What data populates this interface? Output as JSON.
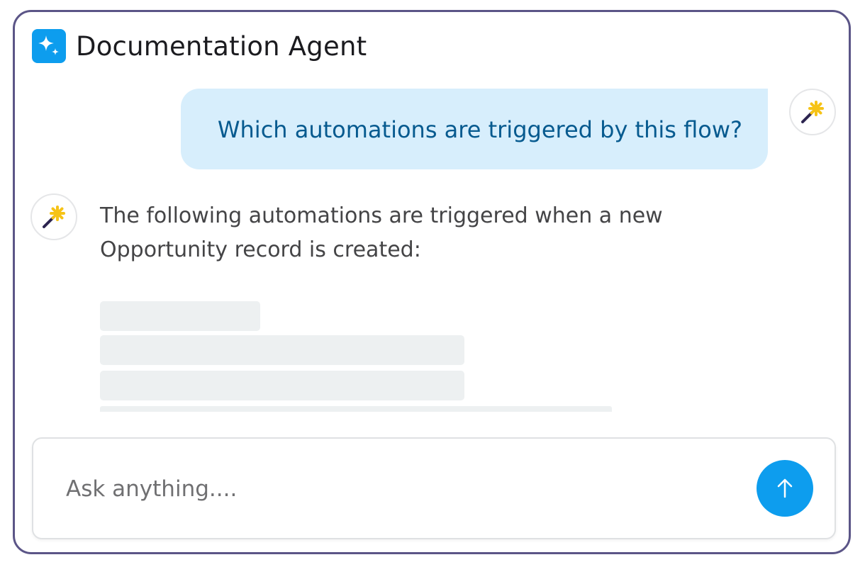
{
  "header": {
    "title": "Documentation Agent",
    "logo_icon": "sparkles-icon"
  },
  "conversation": {
    "user_message": "Which automations are triggered by this flow?",
    "agent_message": "The following automations are triggered when a new Opportunity record is created:",
    "user_avatar_icon": "magic-wand-icon",
    "agent_avatar_icon": "magic-wand-icon",
    "loading_placeholder_lines": 4
  },
  "composer": {
    "placeholder": "Ask anything....",
    "value": "",
    "send_icon": "arrow-up-icon"
  },
  "colors": {
    "accent": "#0d9dee",
    "panel_border": "#5b5587",
    "user_bubble": "#d7eefc",
    "user_text": "#065a8f",
    "agent_text": "#444446",
    "skeleton": "#edf0f1",
    "wand_star": "#f6c317",
    "wand_stick": "#2c2450"
  }
}
